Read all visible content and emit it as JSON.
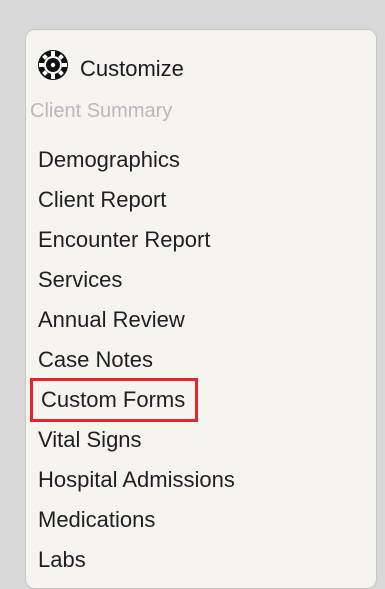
{
  "header": {
    "icon": "gear-icon",
    "label": "Customize"
  },
  "section": {
    "label": "Client Summary"
  },
  "menu": {
    "items": [
      {
        "label": "Demographics"
      },
      {
        "label": "Client Report"
      },
      {
        "label": "Encounter Report"
      },
      {
        "label": "Services"
      },
      {
        "label": "Annual Review"
      },
      {
        "label": "Case Notes"
      },
      {
        "label": "Custom Forms",
        "highlighted": true
      },
      {
        "label": "Vital Signs"
      },
      {
        "label": "Hospital Admissions"
      },
      {
        "label": "Medications"
      },
      {
        "label": "Labs"
      }
    ]
  },
  "colors": {
    "highlight_border": "#e3262d",
    "section_text": "#b9b9b9",
    "panel_background": "#f6f4ef"
  }
}
